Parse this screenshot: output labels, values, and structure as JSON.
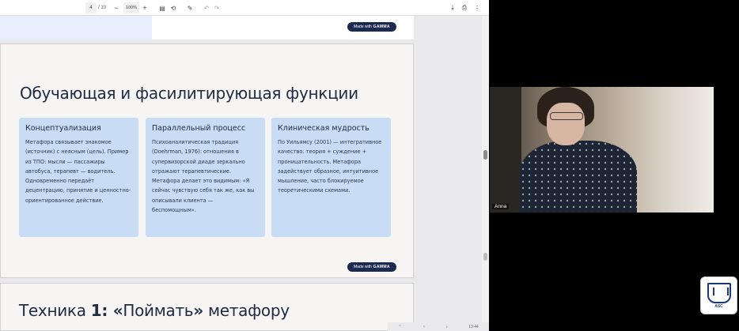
{
  "toolbar": {
    "page_current": "4",
    "page_total": "/ 10",
    "zoom_minus": "−",
    "zoom_value": "100%",
    "zoom_plus": "+",
    "icons": [
      "fit-page-icon",
      "rotate-icon",
      "draw-icon",
      "undo-icon",
      "redo-icon",
      "download-icon",
      "print-icon",
      "more-icon"
    ]
  },
  "made_with": {
    "prefix": "Made with",
    "brand": "GAMMA"
  },
  "slide": {
    "title": "Обучающая и фасилитирующая функции",
    "cards": [
      {
        "heading": "Концептуализация",
        "body": "Метафора связывает знакомое (источник) с неясным (цель). Пример из ТПО: мысли — пассажиры автобуса, терапевт — водитель. Одновременно передаёт децентрацию, принятие и ценностно-ориентированное действие."
      },
      {
        "heading": "Параллельный процесс",
        "body": "Психоаналитическая традиция (Doehrman, 1976): отношения в супервизорской диаде зеркально отражают терапевтические. Метафора делает это видимым: «Я сейчас чувствую себя так же, как вы описывали клиента — беспомощным»."
      },
      {
        "heading": "Клиническая мудрость",
        "body": "По Уильямсу (2001) — интегративное качество: теория + суждение + проницательность. Метафора задействует образное, интуитивное мышление, часто блокируемое теоретическими схемами."
      }
    ]
  },
  "next_slide": {
    "title_prefix": "Техника ",
    "title_bold": "1: «",
    "title_mid": "Поймать",
    "title_bold2": "»",
    "title_suffix": " метафору"
  },
  "video": {
    "participant_name": "Anna"
  },
  "logo": {
    "text": "ASC"
  },
  "taskbar": {
    "time": "13:44"
  }
}
